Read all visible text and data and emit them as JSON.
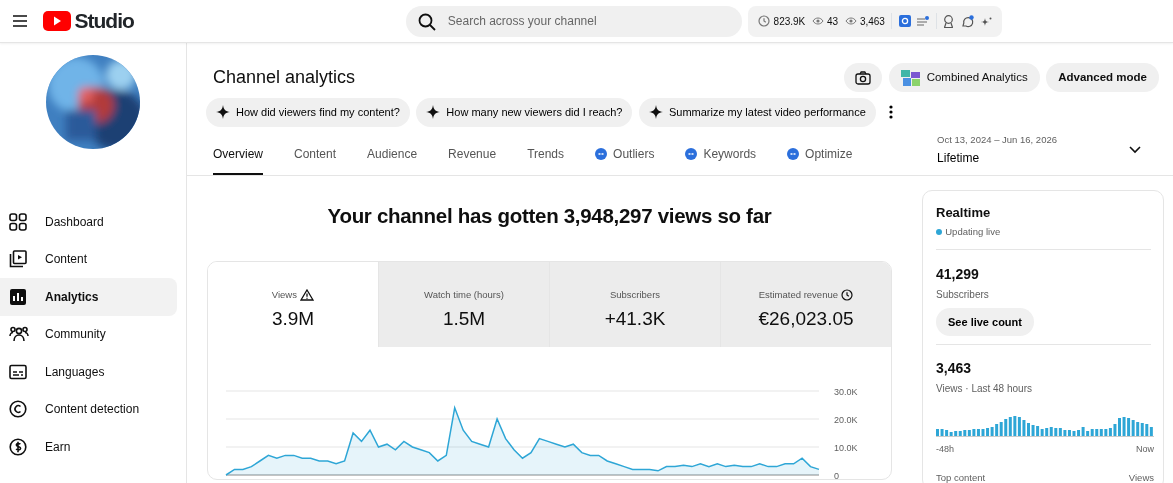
{
  "header": {
    "logo": "Studio",
    "search": {
      "placeholder": "Search across your channel"
    },
    "stats": [
      {
        "kind": "clock",
        "value": "823.9K"
      },
      {
        "kind": "eye",
        "value": "43"
      },
      {
        "kind": "eye",
        "value": "3,463"
      }
    ]
  },
  "sidebar": {
    "items": [
      {
        "label": "Dashboard",
        "selected": false
      },
      {
        "label": "Content",
        "selected": false
      },
      {
        "label": "Analytics",
        "selected": true
      },
      {
        "label": "Community",
        "selected": false
      },
      {
        "label": "Languages",
        "selected": false
      },
      {
        "label": "Content detection",
        "selected": false
      },
      {
        "label": "Earn",
        "selected": false
      }
    ]
  },
  "page": {
    "title": "Channel analytics",
    "actions": [
      {
        "kind": "camera"
      },
      {
        "kind": "combined",
        "label": "Combined Analytics"
      },
      {
        "kind": "text",
        "label": "Advanced mode"
      }
    ],
    "prompts": [
      "How did viewers find my content?",
      "How many new viewers did I reach?",
      "Summarize my latest video performance"
    ],
    "tabs": [
      {
        "label": "Overview",
        "kind": "plain",
        "selected": true
      },
      {
        "label": "Content",
        "kind": "plain",
        "selected": false
      },
      {
        "label": "Audience",
        "kind": "plain",
        "selected": false
      },
      {
        "label": "Revenue",
        "kind": "plain",
        "selected": false
      },
      {
        "label": "Trends",
        "kind": "plain",
        "selected": false
      },
      {
        "label": "Outliers",
        "kind": "extension",
        "selected": false
      },
      {
        "label": "Keywords",
        "kind": "extension",
        "selected": false
      },
      {
        "label": "Optimize",
        "kind": "extension",
        "selected": false
      }
    ],
    "date_range": {
      "dates": "Oct 13, 2024 – Jun 16, 2026",
      "label": "Lifetime"
    }
  },
  "overview": {
    "headline": "Your channel has gotten 3,948,297 views so far",
    "metrics": [
      {
        "label": "Views",
        "kind": "warning",
        "value": "3.9M",
        "selected": true
      },
      {
        "label": "Watch time (hours)",
        "kind": "plain",
        "value": "1.5M",
        "selected": false
      },
      {
        "label": "Subscribers",
        "kind": "plain",
        "value": "+41.3K",
        "selected": false
      },
      {
        "label": "Estimated revenue",
        "kind": "clock",
        "value": "€26,023.05",
        "selected": false
      }
    ],
    "chart_data": {
      "type": "area",
      "ylim": [
        0,
        30000
      ],
      "yticks": [
        {
          "value": 0,
          "label": "0"
        },
        {
          "value": 10000,
          "label": "10.0K"
        },
        {
          "value": 20000,
          "label": "20.0K"
        },
        {
          "value": 30000,
          "label": "30.0K"
        }
      ],
      "series": [
        {
          "color": "#2ea6d6",
          "values": [
            0,
            2000,
            2000,
            3000,
            5000,
            7000,
            6000,
            7000,
            7000,
            6000,
            6000,
            5000,
            5000,
            4000,
            5000,
            15000,
            12000,
            16000,
            10000,
            11000,
            9000,
            12000,
            10000,
            9000,
            8000,
            5000,
            7000,
            24000,
            16000,
            12000,
            11000,
            10000,
            20000,
            13000,
            9000,
            6000,
            8000,
            13000,
            12000,
            11000,
            10000,
            11000,
            8000,
            7000,
            7000,
            5000,
            4000,
            3000,
            2000,
            2000,
            2000,
            1500,
            3000,
            3000,
            3500,
            3000,
            4000,
            3000,
            4000,
            3000,
            3500,
            3000,
            3000,
            4000,
            3000,
            3000,
            4000,
            4000,
            6000,
            3000,
            2000
          ]
        }
      ]
    }
  },
  "realtime": {
    "title": "Realtime",
    "status": "Updating live",
    "subscribers": {
      "value": "41,299",
      "label": "Subscribers"
    },
    "button": "See live count",
    "views": {
      "value": "3,463",
      "label": "Views · Last 48 hours"
    },
    "axis": [
      "-48h",
      "Now"
    ],
    "table_header": [
      "Top content",
      "Views"
    ]
  }
}
